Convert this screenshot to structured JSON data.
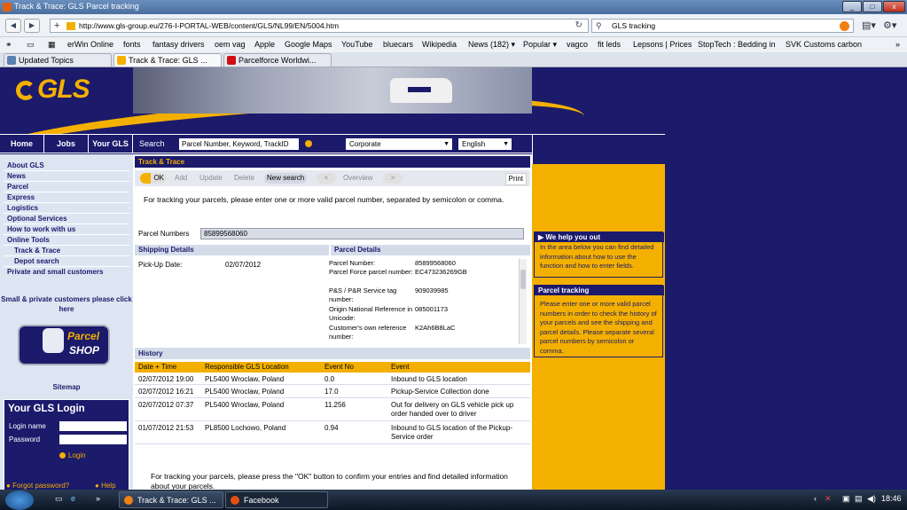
{
  "window": {
    "title": "Track & Trace: GLS Parcel tracking",
    "buttons": [
      "_",
      "□",
      "x"
    ]
  },
  "browser": {
    "url": "http://www.gls-group.eu/276-I-PORTAL-WEB/content/GLS/NL99/EN/5004.htm",
    "search_value": "GLS tracking",
    "bookmarks": [
      "erWin Online",
      "fonts",
      "fantasy drivers",
      "oem vag",
      "Apple",
      "Google Maps",
      "YouTube",
      "bluecars",
      "Wikipedia",
      "News (182) ▾",
      "Popular ▾",
      "vagco",
      "fit leds",
      "Lepsons | Prices",
      "StopTech : Bedding in",
      "SVK Customs carbon"
    ],
    "tabs": [
      {
        "label": "Updated Topics",
        "color": "#5a7fb0"
      },
      {
        "label": "Track & Trace: GLS ...",
        "color": "#f3b000"
      },
      {
        "label": "Parcelforce Worldwi...",
        "color": "#d01010"
      }
    ]
  },
  "site": {
    "logo": "GLS",
    "nav": [
      "Home",
      "Jobs",
      "Your GLS"
    ],
    "search_label": "Search",
    "search_placeholder": "Parcel Number, Keyword, TrackID",
    "segment_select": "Corporate",
    "language_select": "English"
  },
  "sidebar": {
    "items": [
      "About GLS",
      "News",
      "Parcel",
      "Express",
      "Logistics",
      "Optional Services",
      "How to work with us",
      "Online Tools",
      "Track & Trace",
      "Depot search",
      "Private and small customers"
    ],
    "promo": "Small & private customers please click here",
    "parcelshop_top": "Parcel",
    "parcelshop_bottom": "SHOP",
    "sitemap": "Sitemap"
  },
  "login": {
    "title": "Your GLS Login",
    "login_name_label": "Login name",
    "password_label": "Password",
    "login_button": "Login",
    "forgot": "Forgot password?",
    "help": "Help"
  },
  "track": {
    "title": "Track & Trace",
    "toolbar": [
      "OK",
      "Add",
      "Update",
      "Delete",
      "New search",
      "<",
      "Overview",
      ">",
      "Print"
    ],
    "intro": "For tracking your parcels, please enter one or more valid parcel number, separated by semicolon or comma.",
    "parcel_numbers_label": "Parcel Numbers",
    "parcel_numbers_value": "85899568060",
    "shipping_details_head": "Shipping Details",
    "parcel_details_head": "Parcel Details",
    "pickup_label": "Pick-Up Date:",
    "pickup_value": "02/07/2012",
    "details": [
      {
        "label": "Parcel Number:",
        "value": "85899568060"
      },
      {
        "label": "Parcel Force parcel number:",
        "value": "EC473236269GB"
      },
      {
        "label": "P&S / P&R Service tag number:",
        "value": "909039985"
      },
      {
        "label": "Origin National Reference in Unicode:",
        "value": "085001173"
      },
      {
        "label": "Customer's own reference number:",
        "value": "K2Ah6B8LaC"
      }
    ],
    "history_head": "History",
    "history_columns": [
      "Date + Time",
      "Responsible GLS Location",
      "Event No",
      "Event"
    ],
    "history": [
      {
        "date": "02/07/2012 19:00",
        "location": "PL5400 Wroclaw, Poland",
        "event_no": "0.0",
        "event": "Inbound to GLS location"
      },
      {
        "date": "02/07/2012 16:21",
        "location": "PL5400 Wroclaw, Poland",
        "event_no": "17.0",
        "event": "Pickup-Service Collection done"
      },
      {
        "date": "02/07/2012 07:37",
        "location": "PL5400 Wroclaw, Poland",
        "event_no": "11.256",
        "event": "Out for delivery on GLS vehicle pick up order handed over to driver"
      },
      {
        "date": "01/07/2012 21:53",
        "location": "PL8500 Lochowo, Poland",
        "event_no": "0.94",
        "event": "Inbound to GLS location of the Pickup-Service order"
      }
    ],
    "footer_note": "For tracking your parcels, please press the \"OK\" button to confirm your entries and find detailed information about your parcels."
  },
  "help_panel": {
    "help_title": "We help you out",
    "help_text": "In the area below you can find detailed information about how to use the function and how to enter fields.",
    "tracking_title": "Parcel tracking",
    "tracking_text": "Please enter one or more valid parcel numbers in order to check the history of your parcels and see the shipping and parcel details. Please separate several parcel numbers by semicolon or comma."
  },
  "taskbar": {
    "items": [
      "Track & Trace: GLS ...",
      "Facebook"
    ],
    "clock": "18:46"
  },
  "colors": {
    "gls_blue": "#1b1a6b",
    "gls_yellow": "#f3b000"
  }
}
